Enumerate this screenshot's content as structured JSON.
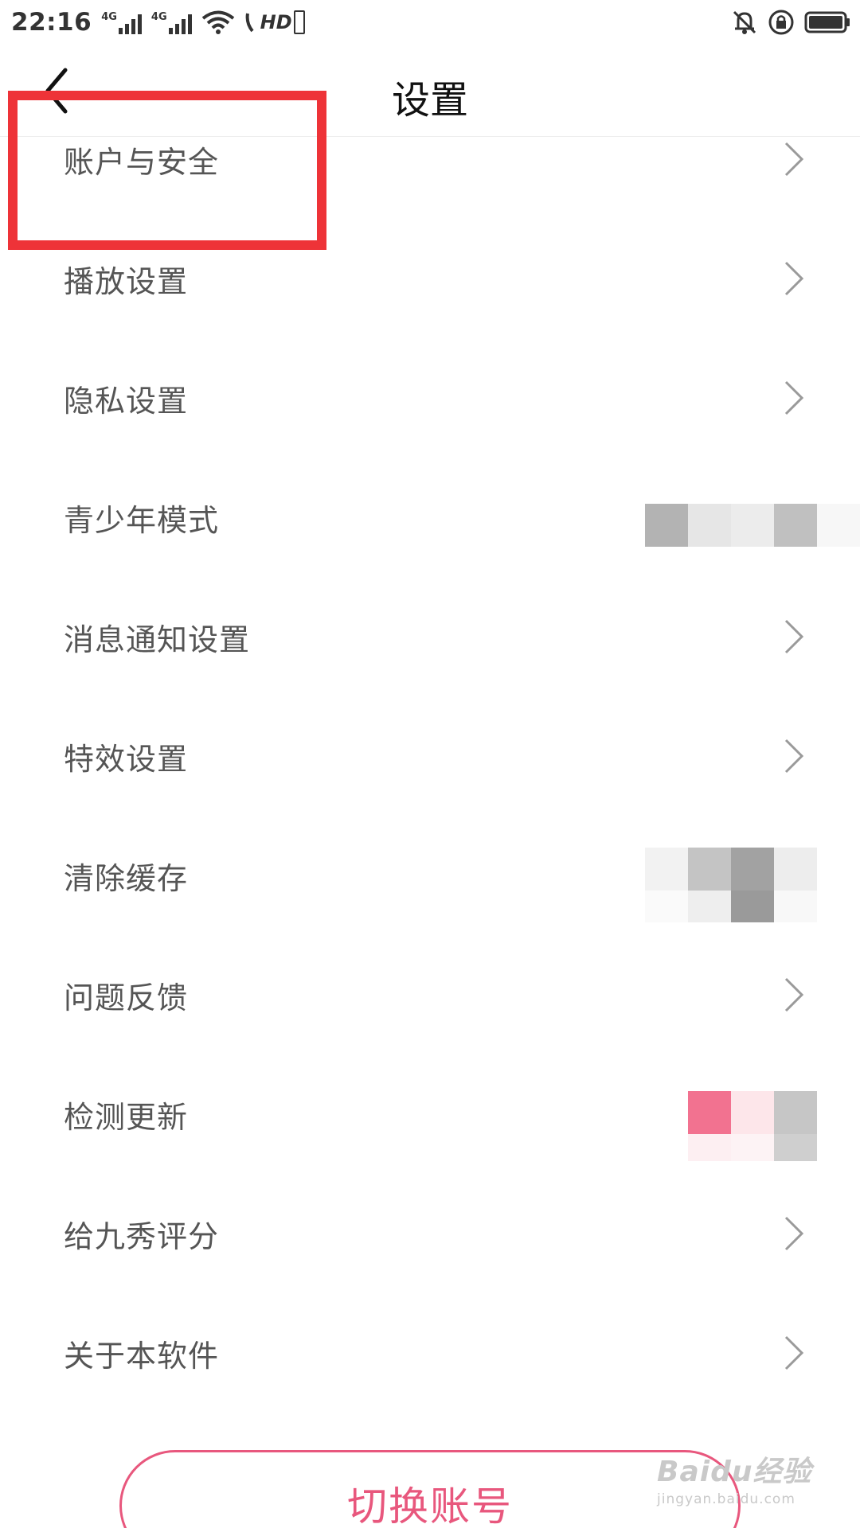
{
  "status_bar": {
    "time": "22:16",
    "network_1": "4G",
    "network_2": "4G",
    "hd_label": "HD",
    "icons": [
      "signal-icon",
      "signal-icon",
      "wifi-icon",
      "hd-icon",
      "bell-off-icon",
      "rotation-lock-icon",
      "battery-icon"
    ]
  },
  "header": {
    "title": "设置",
    "back_icon": "chevron-left-icon"
  },
  "settings": [
    {
      "label": "账户与安全",
      "trailing": "chevron-right-icon"
    },
    {
      "label": "播放设置",
      "trailing": "chevron-right-icon"
    },
    {
      "label": "隐私设置",
      "trailing": "chevron-right-icon"
    },
    {
      "label": "青少年模式",
      "trailing": "pixelated"
    },
    {
      "label": "消息通知设置",
      "trailing": "chevron-right-icon"
    },
    {
      "label": "特效设置",
      "trailing": "chevron-right-icon"
    },
    {
      "label": "清除缓存",
      "trailing": "pixelated"
    },
    {
      "label": "问题反馈",
      "trailing": "chevron-right-icon"
    },
    {
      "label": "检测更新",
      "trailing": "pixelated"
    },
    {
      "label": "给九秀评分",
      "trailing": "chevron-right-icon"
    },
    {
      "label": "关于本软件",
      "trailing": "chevron-right-icon"
    }
  ],
  "switch_account": {
    "label": "切换账号"
  },
  "watermark": {
    "main": "Baidu经验",
    "sub": "jingyan.baidu.com"
  },
  "colors": {
    "accent": "#e8577d",
    "highlight": "#ee3338",
    "text": "#555555",
    "chevron": "#9a9a9a"
  }
}
